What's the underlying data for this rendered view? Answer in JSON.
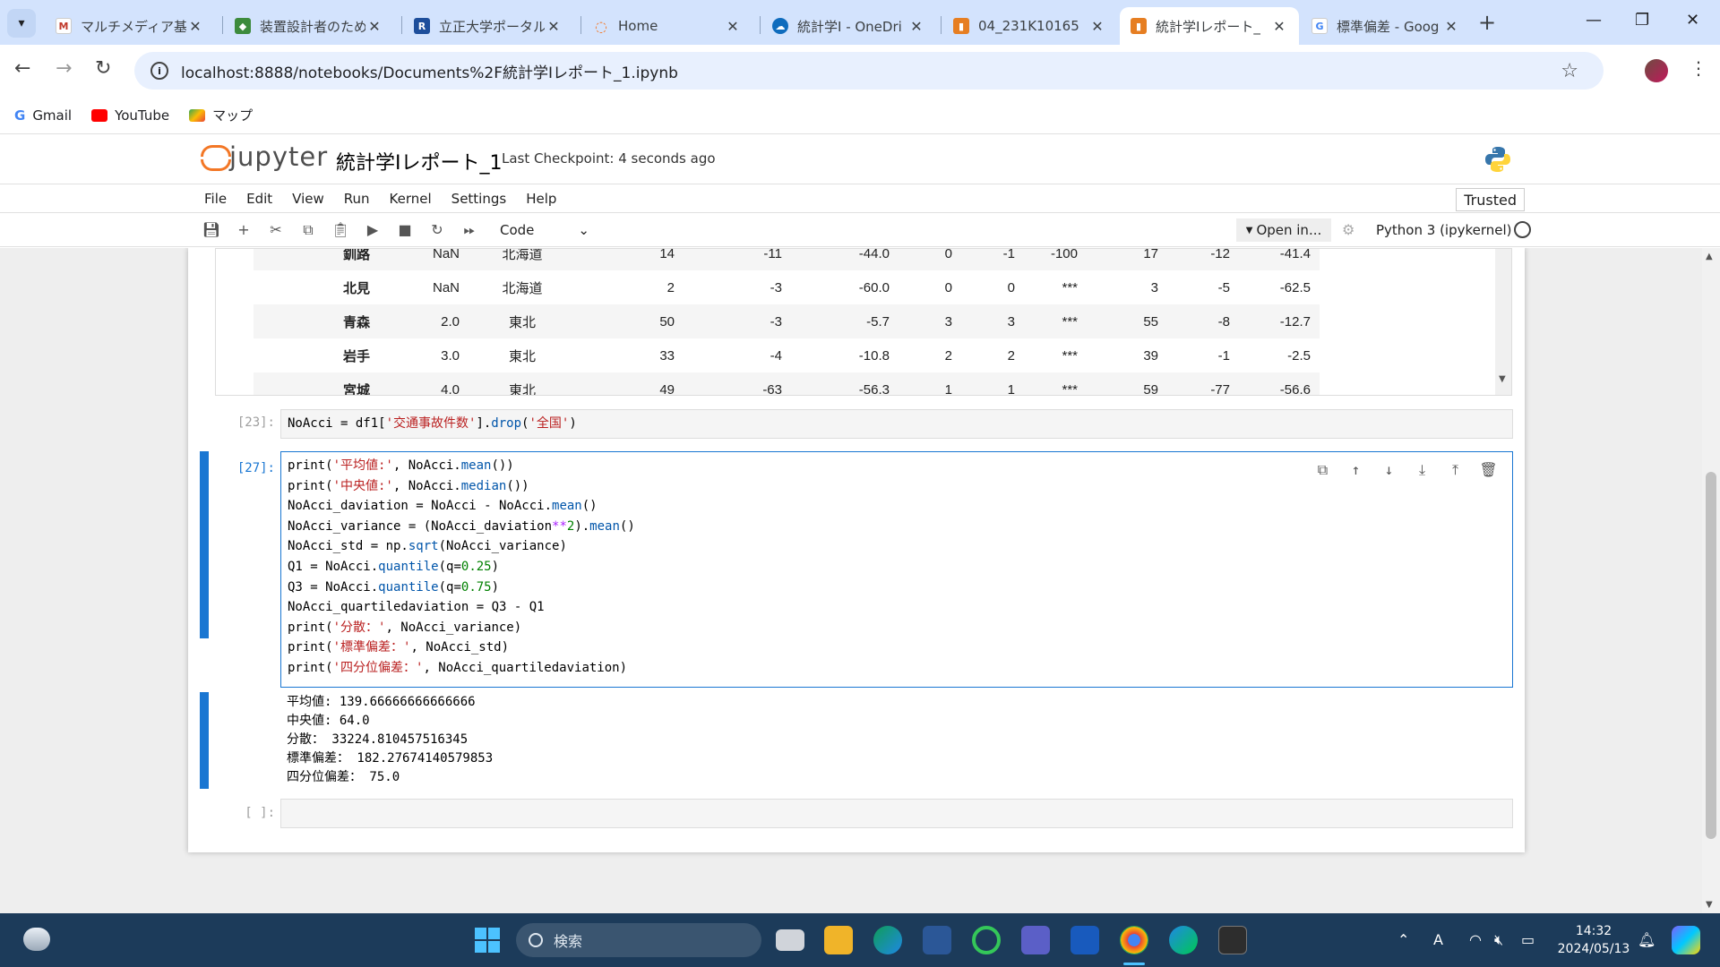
{
  "tabs": [
    {
      "title": "マルチメディア基礎",
      "icon": "moodle-icon",
      "color": "#ffffff"
    },
    {
      "title": "装置設計者のため",
      "icon": "tool-icon",
      "color": "#3d8b3d"
    },
    {
      "title": "立正大学ポータル",
      "icon": "portal-icon",
      "color": "#1d4e9b"
    },
    {
      "title": "Home",
      "icon": "jupyter-icon",
      "color": "#f37726"
    },
    {
      "title": "統計学Ⅰ - OneDri",
      "icon": "onedrive-icon",
      "color": "#0f6cbd"
    },
    {
      "title": "04_231K10165",
      "icon": "notebook-icon",
      "color": "#e67e22"
    },
    {
      "title": "統計学Ⅰレポート_",
      "icon": "notebook-icon",
      "color": "#e67e22"
    },
    {
      "title": "標準偏差 - Goog",
      "icon": "google-icon",
      "color": "#4285f4"
    }
  ],
  "address": {
    "url": "localhost:8888/notebooks/Documents%2F統計学Ⅰレポート_1.ipynb"
  },
  "bookmarks": [
    {
      "label": "Gmail",
      "color": "#ea4335"
    },
    {
      "label": "YouTube",
      "color": "#ff0000"
    },
    {
      "label": "マップ",
      "color": "#34a853"
    }
  ],
  "jupyter": {
    "logo_text": "jupyter",
    "notebook_title": "統計学Ⅰレポート_1",
    "checkpoint": "Last Checkpoint: 4 seconds ago",
    "trusted": "Trusted",
    "menu": [
      "File",
      "Edit",
      "View",
      "Run",
      "Kernel",
      "Settings",
      "Help"
    ],
    "cell_type": "Code",
    "open_in": "Open in...",
    "kernel": "Python 3 (ipykernel)"
  },
  "output_table": {
    "rows": [
      [
        "釧路",
        "NaN",
        "北海道",
        "14",
        "-11",
        "-44.0",
        "0",
        "-1",
        "-100",
        "17",
        "-12",
        "-41.4"
      ],
      [
        "北見",
        "NaN",
        "北海道",
        "2",
        "-3",
        "-60.0",
        "0",
        "0",
        "***",
        "3",
        "-5",
        "-62.5"
      ],
      [
        "青森",
        "2.0",
        "東北",
        "50",
        "-3",
        "-5.7",
        "3",
        "3",
        "***",
        "55",
        "-8",
        "-12.7"
      ],
      [
        "岩手",
        "3.0",
        "東北",
        "33",
        "-4",
        "-10.8",
        "2",
        "2",
        "***",
        "39",
        "-1",
        "-2.5"
      ],
      [
        "宮城",
        "4.0",
        "東北",
        "49",
        "-63",
        "-56.3",
        "1",
        "1",
        "***",
        "59",
        "-77",
        "-56.6"
      ]
    ]
  },
  "cells": {
    "cell23": {
      "prompt": "[23]:",
      "code_prefix": "NoAcci = df1[",
      "code_str1": "'交通事故件数'",
      "code_mid": "].",
      "code_fn": "drop",
      "code_open": "(",
      "code_str2": "'全国'",
      "code_close": ")"
    },
    "cell27": {
      "prompt": "[27]:",
      "lines": [
        "print('平均値:', NoAcci.mean())",
        "print('中央値:', NoAcci.median())",
        "NoAcci_daviation = NoAcci - NoAcci.mean()",
        "NoAcci_variance = (NoAcci_daviation**2).mean()",
        "NoAcci_std = np.sqrt(NoAcci_variance)",
        "Q1 = NoAcci.quantile(q=0.25)",
        "Q3 = NoAcci.quantile(q=0.75)",
        "NoAcci_quartiledaviation = Q3 - Q1",
        "print('分散：', NoAcci_variance)",
        "print('標準偏差：', NoAcci_std)",
        "print('四分位偏差：', NoAcci_quartiledaviation)"
      ],
      "output": [
        "平均値: 139.66666666666666",
        "中央値: 64.0",
        "分散： 33224.810457516345",
        "標準偏差： 182.27674140579853",
        "四分位偏差： 75.0"
      ]
    },
    "empty_prompt": "[ ]:"
  },
  "taskbar": {
    "search_placeholder": "検索",
    "time": "14:32",
    "date": "2024/05/13"
  }
}
